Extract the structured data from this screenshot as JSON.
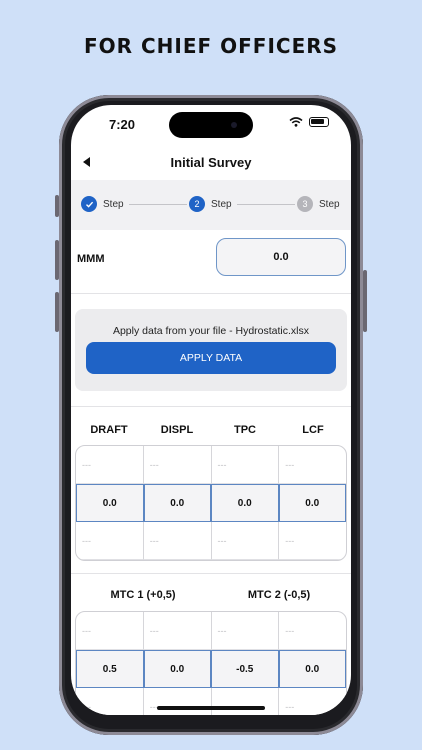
{
  "headline": "FOR CHIEF OFFICERS",
  "status": {
    "time": "7:20"
  },
  "nav": {
    "title": "Initial Survey"
  },
  "stepper": {
    "steps": [
      {
        "number": "",
        "label": "Step",
        "state": "done"
      },
      {
        "number": "2",
        "label": "Step",
        "state": "active"
      },
      {
        "number": "3",
        "label": "Step",
        "state": "pending"
      }
    ]
  },
  "mmm": {
    "label": "MMM",
    "value": "0.0"
  },
  "apply": {
    "text": "Apply data from your file - Hydrostatic.xlsx",
    "button": "APPLY DATA"
  },
  "hydro_table": {
    "headers": [
      "DRAFT",
      "DISPL",
      "TPC",
      "LCF"
    ],
    "rows": [
      [
        "---",
        "---",
        "---",
        "---"
      ],
      [
        "0.0",
        "0.0",
        "0.0",
        "0.0"
      ],
      [
        "---",
        "---",
        "---",
        "---"
      ]
    ]
  },
  "mtc_table": {
    "headers": [
      "MTC 1 (+0,5)",
      "MTC 2 (-0,5)"
    ],
    "rows": [
      [
        "---",
        "---",
        "---",
        "---"
      ],
      [
        "0.5",
        "0.0",
        "-0.5",
        "0.0"
      ],
      [
        "---",
        "---",
        "---",
        "---"
      ]
    ]
  },
  "colors": {
    "accent": "#1f63c6",
    "step_pending": "#b5b5ba",
    "background": "#cfe0f8"
  }
}
